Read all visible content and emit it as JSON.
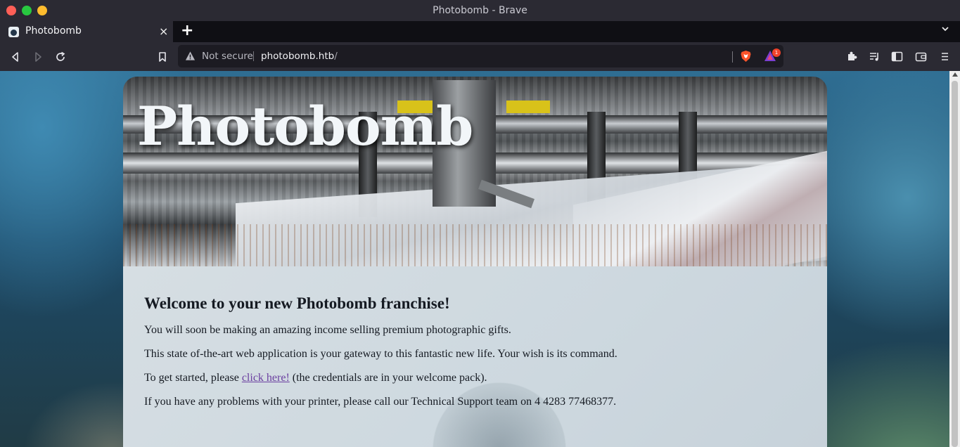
{
  "window": {
    "title": "Photobomb - Brave"
  },
  "tabs": [
    {
      "title": "Photobomb",
      "close_label": "×"
    }
  ],
  "tabstrip": {
    "new_tab_label": "+",
    "menu_label": "⌄"
  },
  "urlbar": {
    "security_label": "Not secure",
    "host": "photobomb.htb",
    "path": "/",
    "rewards_badge": "1"
  },
  "page": {
    "site_title": "Photobomb",
    "heading": "Welcome to your new Photobomb franchise!",
    "paragraphs": {
      "p1": "You will soon be making an amazing income selling premium photographic gifts.",
      "p2": "This state of-the-art web application is your gateway to this fantastic new life. Your wish is its command.",
      "p3_before": "To get started, please ",
      "p3_link": "click here!",
      "p3_after": " (the credentials are in your welcome pack).",
      "p4": "If you have any problems with your printer, please call our Technical Support team on 4 4283 77468377."
    }
  },
  "colors": {
    "titlebar": "#2b2a33",
    "tabstrip": "#0f0f14",
    "link": "#6b3fa0",
    "brave_orange": "#fb542b"
  }
}
